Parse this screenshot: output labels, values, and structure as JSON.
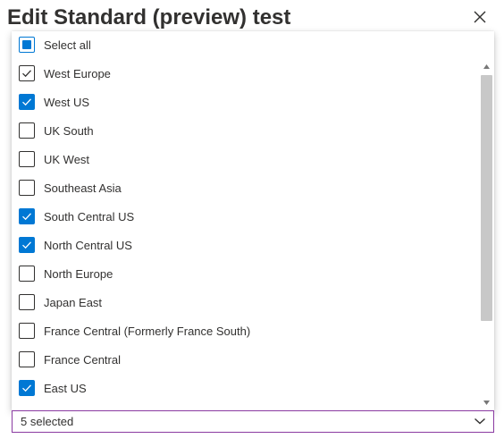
{
  "panel": {
    "title": "Edit Standard (preview) test"
  },
  "icons": {
    "close": "close-icon",
    "check": "checkmark-icon",
    "chevron": "chevron-down-icon"
  },
  "colors": {
    "accent": "#0078d4",
    "focus_border": "#8a3aa1",
    "scroll_thumb": "#c8c8c8"
  },
  "dropdown": {
    "select_all_label": "Select all",
    "select_all_state": "indeterminate",
    "selected_text": "5 selected",
    "options": [
      {
        "label": "West Europe",
        "checked": true,
        "highlighted": true
      },
      {
        "label": "West US",
        "checked": true,
        "highlighted": false
      },
      {
        "label": "UK South",
        "checked": false,
        "highlighted": false
      },
      {
        "label": "UK West",
        "checked": false,
        "highlighted": false
      },
      {
        "label": "Southeast Asia",
        "checked": false,
        "highlighted": false
      },
      {
        "label": "South Central US",
        "checked": true,
        "highlighted": false
      },
      {
        "label": "North Central US",
        "checked": true,
        "highlighted": false
      },
      {
        "label": "North Europe",
        "checked": false,
        "highlighted": false
      },
      {
        "label": "Japan East",
        "checked": false,
        "highlighted": false
      },
      {
        "label": "France Central (Formerly France South)",
        "checked": false,
        "highlighted": false
      },
      {
        "label": "France Central",
        "checked": false,
        "highlighted": false
      },
      {
        "label": "East US",
        "checked": true,
        "highlighted": false
      }
    ]
  }
}
